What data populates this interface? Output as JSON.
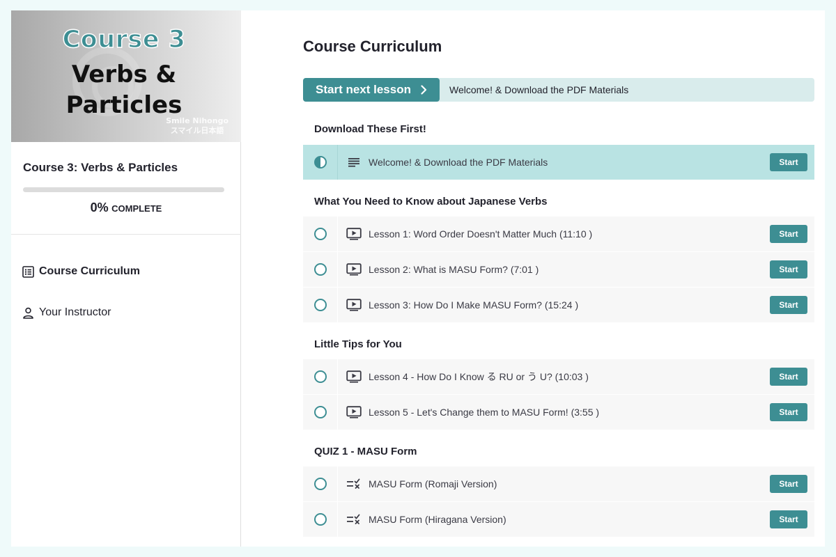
{
  "sidebar": {
    "banner": {
      "course_number": "Course 3",
      "title_line1": "Verbs &",
      "title_line2": "Particles",
      "brand_line1": "Smile Nihongo",
      "brand_line2": "スマイル日本語"
    },
    "course_title": "Course 3: Verbs & Particles",
    "progress": {
      "percent_value": 0,
      "percent_text": "0%",
      "complete_label": "complete"
    },
    "nav": [
      {
        "label": "Course Curriculum",
        "icon": "list-icon"
      },
      {
        "label": "Your Instructor",
        "icon": "user-icon"
      }
    ]
  },
  "main": {
    "title": "Course Curriculum",
    "next_lesson": {
      "button_label": "Start next lesson",
      "lesson_name": "Welcome! & Download the PDF Materials"
    },
    "sections": [
      {
        "title": "Download These First!",
        "lessons": [
          {
            "label": "Welcome! & Download the PDF Materials",
            "type": "text",
            "status": "in-progress",
            "action": "Start"
          }
        ]
      },
      {
        "title": "What You Need to Know about Japanese Verbs",
        "lessons": [
          {
            "label": "Lesson 1: Word Order Doesn't Matter Much (11:10 )",
            "type": "video",
            "status": "not-started",
            "action": "Start"
          },
          {
            "label": "Lesson 2: What is MASU Form? (7:01 )",
            "type": "video",
            "status": "not-started",
            "action": "Start"
          },
          {
            "label": "Lesson 3: How Do I Make MASU Form? (15:24 )",
            "type": "video",
            "status": "not-started",
            "action": "Start"
          }
        ]
      },
      {
        "title": "Little Tips for You",
        "lessons": [
          {
            "label": "Lesson 4 - How Do I Know る RU or う U? (10:03 )",
            "type": "video",
            "status": "not-started",
            "action": "Start"
          },
          {
            "label": "Lesson 5 - Let's Change them to MASU Form! (3:55 )",
            "type": "video",
            "status": "not-started",
            "action": "Start"
          }
        ]
      },
      {
        "title": "QUIZ 1 - MASU Form",
        "lessons": [
          {
            "label": "MASU Form (Romaji Version)",
            "type": "quiz",
            "status": "not-started",
            "action": "Start"
          },
          {
            "label": "MASU Form (Hiragana Version)",
            "type": "quiz",
            "status": "not-started",
            "action": "Start"
          }
        ]
      }
    ]
  },
  "colors": {
    "accent": "#3d8e93",
    "active_row": "#b9e3e3",
    "next_bar": "#d9ecec",
    "page_background": "#effafa"
  }
}
